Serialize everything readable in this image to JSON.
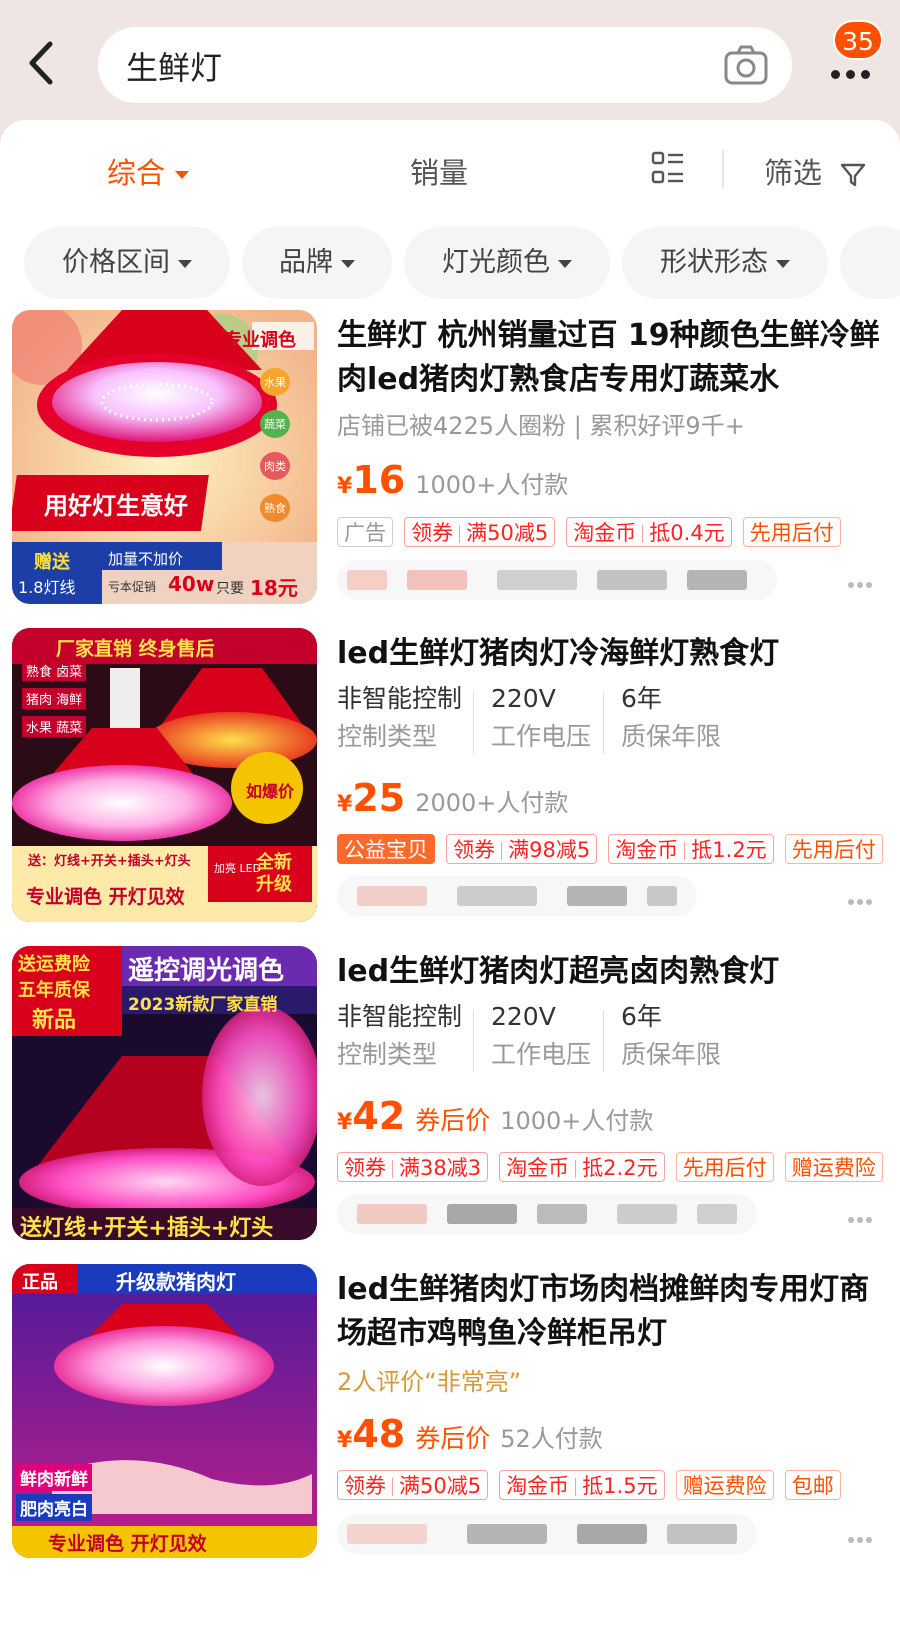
{
  "search": {
    "query": "生鲜灯",
    "cart_badge": "35"
  },
  "sort": {
    "items": [
      "综合",
      "销量"
    ],
    "filter_label": "筛选"
  },
  "filters": [
    "价格区间",
    "品牌",
    "灯光颜色",
    "形状形态"
  ],
  "colors": {
    "accent": "#ff5000",
    "price": "#ff5000"
  },
  "products": [
    {
      "title": "生鲜灯 杭州销量过百 19种颜色生鲜冷鲜肉led猪肉灯熟食店专用灯蔬菜水",
      "meta": "店铺已被4225人圈粉 | 累积好评9千+",
      "currency": "¥",
      "price": "16",
      "sold": "1000+人付款",
      "tags": [
        "广告",
        "领券",
        "满50减5",
        "淘金币",
        "抵0.4元",
        "先用后付"
      ],
      "image_text": {
        "side": "专业调色",
        "side_items": [
          "水果",
          "蔬菜",
          "肉类",
          "熟食"
        ],
        "banner": "用好灯生意好",
        "gift": "赠送",
        "gift_detail": "1.8灯线",
        "promo": "加量不加价",
        "promo_detail": "亏本促销",
        "watt": "40w",
        "only": "只要",
        "yuan": "18元"
      }
    },
    {
      "title": "led生鲜灯猪肉灯冷海鲜灯熟食灯",
      "specs": [
        {
          "value": "非智能控制",
          "key": "控制类型"
        },
        {
          "value": "220V",
          "key": "工作电压"
        },
        {
          "value": "6年",
          "key": "质保年限"
        }
      ],
      "currency": "¥",
      "price": "25",
      "sold": "2000+人付款",
      "tags": [
        "公益宝贝",
        "领券",
        "满98减5",
        "淘金币",
        "抵1.2元",
        "先用后付"
      ],
      "image_text": {
        "header": "厂家直销 终身售后",
        "uses": [
          "熟食 卤菜",
          "猪肉 海鲜",
          "水果 蔬菜"
        ],
        "badge": "如爆价",
        "gift": "送：灯线+开关+插头+灯头",
        "upgrade_small": "加亮 LED",
        "upgrade": "全新升级",
        "footer": "专业调色 开灯见效"
      }
    },
    {
      "title": "led生鲜灯猪肉灯超亮卤肉熟食灯",
      "specs": [
        {
          "value": "非智能控制",
          "key": "控制类型"
        },
        {
          "value": "220V",
          "key": "工作电压"
        },
        {
          "value": "6年",
          "key": "质保年限"
        }
      ],
      "currency": "¥",
      "price": "42",
      "after_coupon": "券后价",
      "sold": "1000+人付款",
      "tags": [
        "领券",
        "满38减3",
        "淘金币",
        "抵2.2元",
        "先用后付",
        "赠运费险"
      ],
      "image_text": {
        "left1": "送运费险",
        "left2": "五年质保",
        "left3": "新品",
        "right": "遥控调光调色",
        "right2": "2023新款厂家直销",
        "footer": "送灯线+开关+插头+灯头"
      }
    },
    {
      "title": "led生鲜猪肉灯市场肉档摊鲜肉专用灯商场超市鸡鸭鱼冷鲜柜吊灯",
      "review": "2人评价“非常亮”",
      "currency": "¥",
      "price": "48",
      "after_coupon": "券后价",
      "sold": "52人付款",
      "tags": [
        "领券",
        "满50减5",
        "淘金币",
        "抵1.5元",
        "赠运费险",
        "包邮"
      ],
      "image_text": {
        "badge": "正品",
        "header": "升级款猪肉灯",
        "side1": "鲜肉新鲜",
        "side2": "肥肉亮白",
        "footer": "专业调色 开灯见效"
      }
    }
  ]
}
